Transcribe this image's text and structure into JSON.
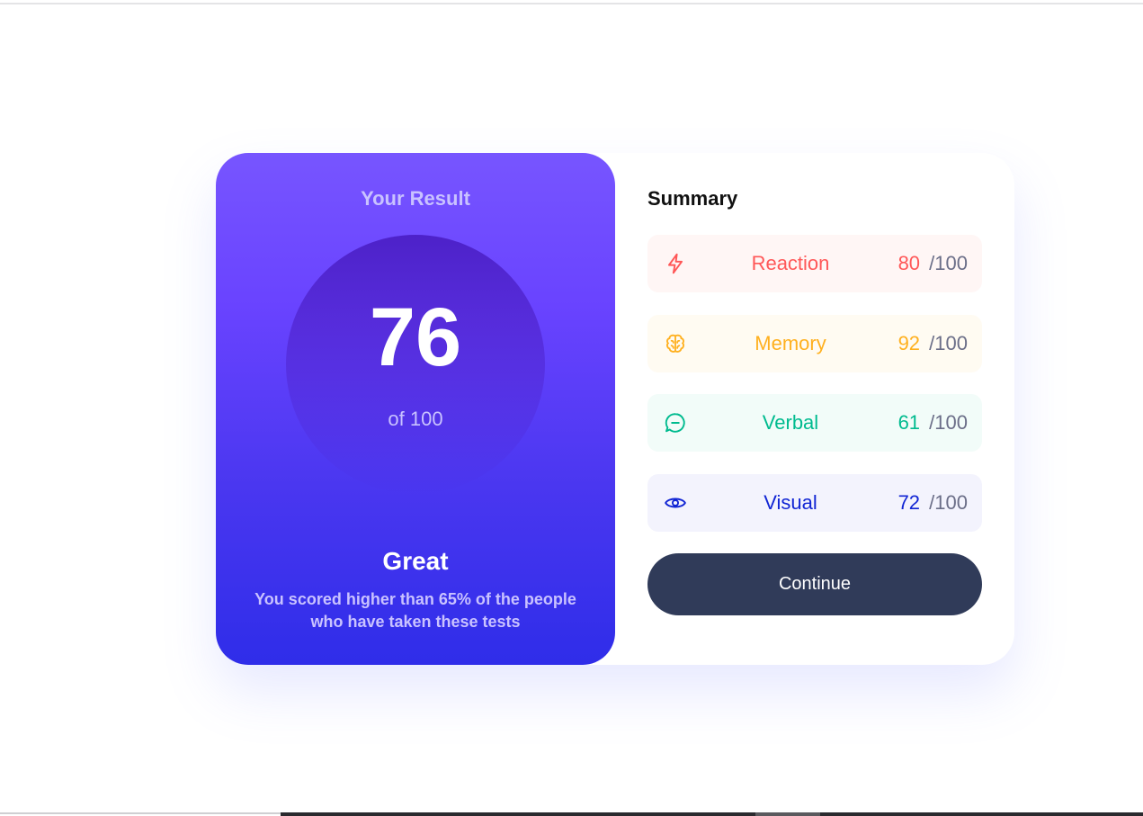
{
  "result": {
    "title": "Your Result",
    "score": "76",
    "score_max": "of 100",
    "verdict": "Great",
    "description": "You scored higher than 65% of the people who have taken these tests"
  },
  "summary": {
    "title": "Summary",
    "items": [
      {
        "label": "Reaction",
        "score": "80",
        "max": "/100",
        "icon": "lightning-icon",
        "color": "#ff5757",
        "bg": "#fff6f5"
      },
      {
        "label": "Memory",
        "score": "92",
        "max": "/100",
        "icon": "brain-icon",
        "color": "#ffb01f",
        "bg": "#fffbf2"
      },
      {
        "label": "Verbal",
        "score": "61",
        "max": "/100",
        "icon": "chat-bubble-icon",
        "color": "#00bb8f",
        "bg": "#f2fcf9"
      },
      {
        "label": "Visual",
        "score": "72",
        "max": "/100",
        "icon": "eye-icon",
        "color": "#1125d4",
        "bg": "#f3f3fd"
      }
    ]
  },
  "continue_label": "Continue",
  "colors": {
    "accent_purple": "#7755ff",
    "accent_blue": "#2f2de9",
    "button": "#303b59"
  }
}
